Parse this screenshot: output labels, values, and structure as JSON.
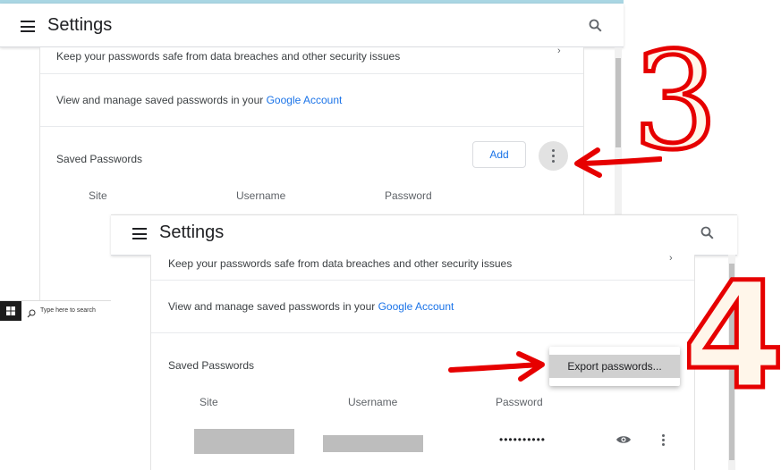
{
  "top": {
    "title": "Settings",
    "security_text": "Keep your passwords safe from data breaches and other security issues",
    "manage_prefix": "View and manage saved passwords in your ",
    "manage_link": "Google Account",
    "saved_passwords": "Saved Passwords",
    "add_label": "Add",
    "columns": [
      "Site",
      "Username",
      "Password"
    ]
  },
  "bottom": {
    "title": "Settings",
    "security_text": "Keep your passwords safe from data breaches and other security issues",
    "manage_prefix": "View and manage saved passwords in your ",
    "manage_link": "Google Account",
    "saved_passwords": "Saved Passwords",
    "menu_item": "Export passwords...",
    "columns": [
      "Site",
      "Username",
      "Password"
    ],
    "password_mask": "••••••••••"
  },
  "taskbar": {
    "search_placeholder": "Type here to search"
  },
  "annotations": {
    "step_a": "3",
    "step_b": "4",
    "arrow_color": "#e60000"
  },
  "colors": {
    "link": "#1a73e8",
    "top_strip": "#a9d6e3"
  }
}
